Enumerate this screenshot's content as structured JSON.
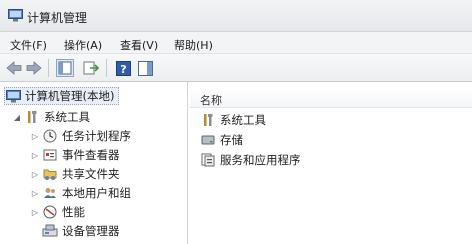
{
  "window": {
    "title": "计算机管理"
  },
  "menu": [
    "文件(F)",
    "操作(A)",
    "查看(V)",
    "帮助(H)"
  ],
  "toolbar": {
    "buttons": [
      "back-icon",
      "forward-icon",
      "show-hide-tree-icon",
      "export-list-icon",
      "help-icon",
      "action-pane-icon"
    ]
  },
  "tree": {
    "root": "计算机管理(本地)",
    "system_tools": "系统工具",
    "children": [
      "任务计划程序",
      "事件查看器",
      "共享文件夹",
      "本地用户和组",
      "性能",
      "设备管理器"
    ]
  },
  "list": {
    "column_header": "名称",
    "items": [
      "系统工具",
      "存储",
      "服务和应用程序"
    ]
  }
}
